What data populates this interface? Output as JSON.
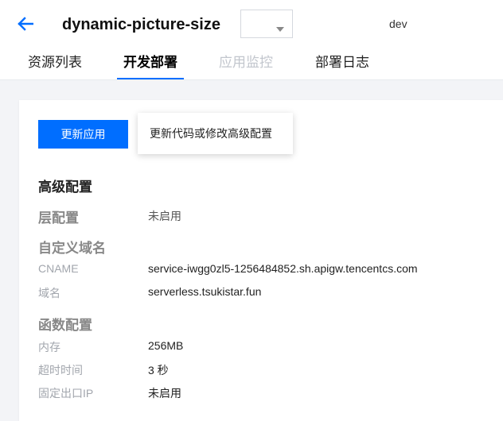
{
  "header": {
    "back_icon": "arrow-left-icon",
    "title": "dynamic-picture-size",
    "env_select": {
      "value": "dev",
      "caret_icon": "caret-down-icon"
    },
    "accent_color": "#006eff"
  },
  "tabs": [
    {
      "label": "资源列表",
      "state": "normal"
    },
    {
      "label": "开发部署",
      "state": "active"
    },
    {
      "label": "应用监控",
      "state": "disabled"
    },
    {
      "label": "部署日志",
      "state": "normal"
    }
  ],
  "actions": {
    "update_button": "更新应用",
    "tooltip": "更新代码或修改高级配置"
  },
  "advanced": {
    "title": "高级配置",
    "layer": {
      "title": "层配置",
      "value": "未启用"
    },
    "domain": {
      "title": "自定义域名",
      "rows": [
        {
          "label": "CNAME",
          "value": "service-iwgg0zl5-1256484852.sh.apigw.tencentcs.com"
        },
        {
          "label": "域名",
          "value": "serverless.tsukistar.fun"
        }
      ]
    },
    "function": {
      "title": "函数配置",
      "rows": [
        {
          "label": "内存",
          "value": "256MB"
        },
        {
          "label": "超时时间",
          "value": "3 秒"
        },
        {
          "label": "固定出口IP",
          "value": "未启用"
        }
      ]
    }
  }
}
